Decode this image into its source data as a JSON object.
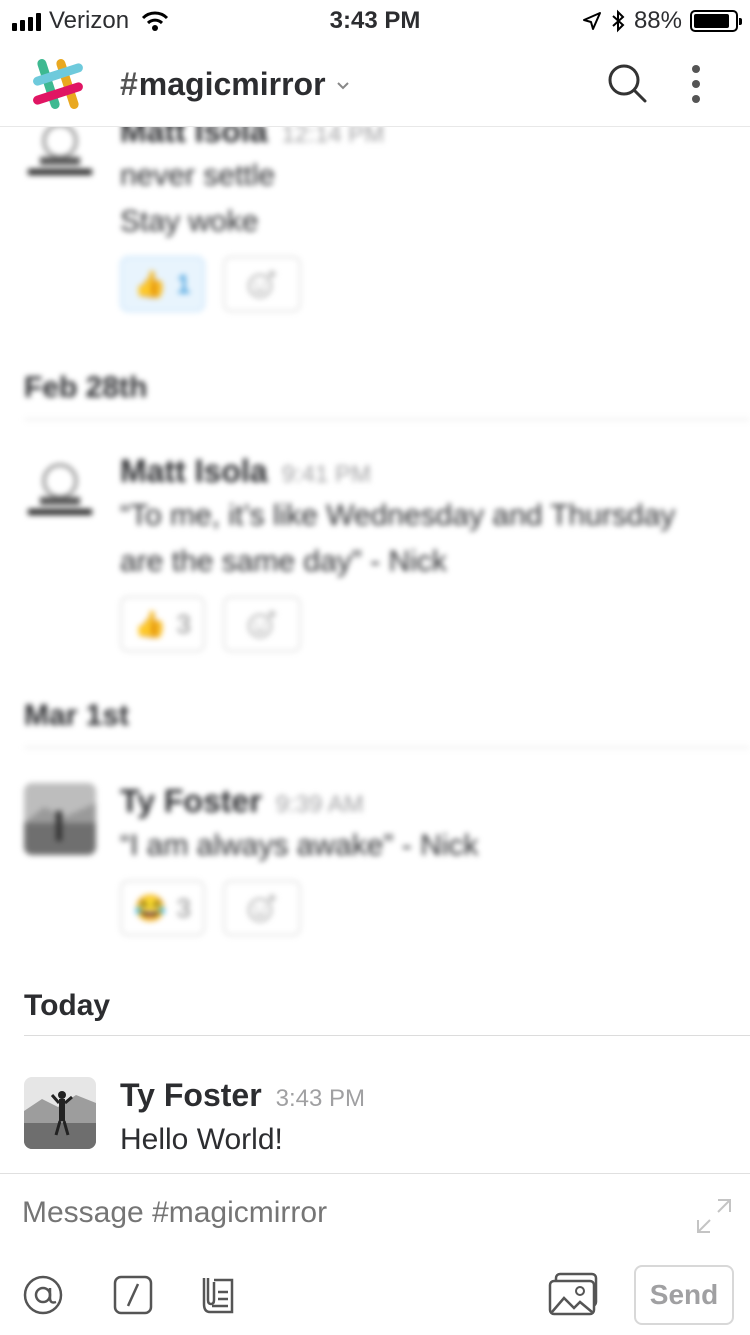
{
  "status_bar": {
    "carrier": "Verizon",
    "time": "3:43 PM",
    "battery": "88%",
    "battery_level": 0.88
  },
  "header": {
    "channel_prefix": "#",
    "channel_name": "magicmirror"
  },
  "messages": [
    {
      "author": "Matt Isola",
      "time": "12:14 PM",
      "lines": [
        "never settle",
        "Stay woke"
      ],
      "reactions": [
        {
          "emoji": "👍",
          "count": "1"
        }
      ]
    },
    {
      "author": "Matt Isola",
      "time": "9:41 PM",
      "lines": [
        "“To me, it’s like Wednesday and Thursday",
        "are the same day” - Nick"
      ],
      "reactions": [
        {
          "emoji": "👍",
          "count": "3"
        }
      ]
    },
    {
      "author": "Ty Foster",
      "time": "9:39 AM",
      "lines": [
        "“I am always awake” - Nick"
      ],
      "reactions": [
        {
          "emoji": "😂",
          "count": "3"
        }
      ]
    },
    {
      "author": "Ty Foster",
      "time": "3:43 PM",
      "lines": [
        "Hello World!"
      ]
    }
  ],
  "days": [
    "Feb 28th",
    "Mar 1st",
    "Today"
  ],
  "composer": {
    "placeholder": "Message #magicmirror",
    "send_label": "Send"
  },
  "colors": {
    "accent_blue": "#1d8bd6",
    "text": "#2c2d30",
    "muted": "#a0a0a2"
  }
}
